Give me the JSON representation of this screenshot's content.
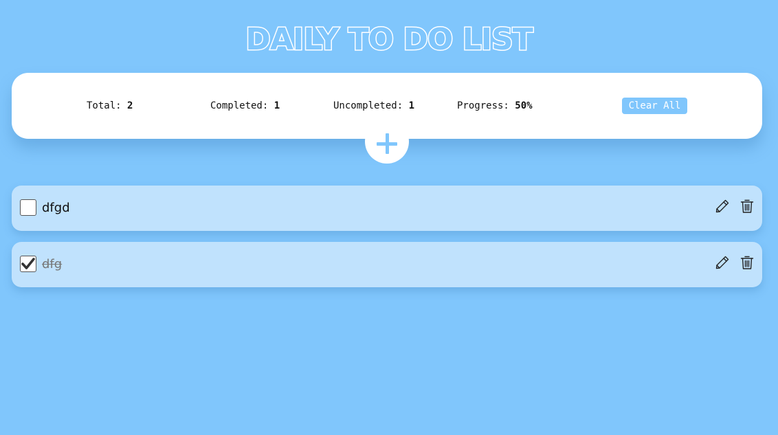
{
  "header": {
    "title": "DAILY TO DO LIST"
  },
  "stats": {
    "total_label": "Total:",
    "total_value": "2",
    "completed_label": "Completed:",
    "completed_value": "1",
    "uncompleted_label": "Uncompleted:",
    "uncompleted_value": "1",
    "progress_label": "Progress:",
    "progress_value": "50%",
    "clear_all_label": "Clear All"
  },
  "add_button": {
    "icon": "plus-icon"
  },
  "tasks": [
    {
      "text": "dfgd",
      "completed": false,
      "edit_icon": "pencil-icon",
      "delete_icon": "trash-icon"
    },
    {
      "text": "dfg",
      "completed": true,
      "edit_icon": "pencil-icon",
      "delete_icon": "trash-icon"
    }
  ],
  "colors": {
    "background": "#80c6fc",
    "card": "#ffffff",
    "task_background": "#c0e2fd",
    "accent": "#80c6fc"
  }
}
